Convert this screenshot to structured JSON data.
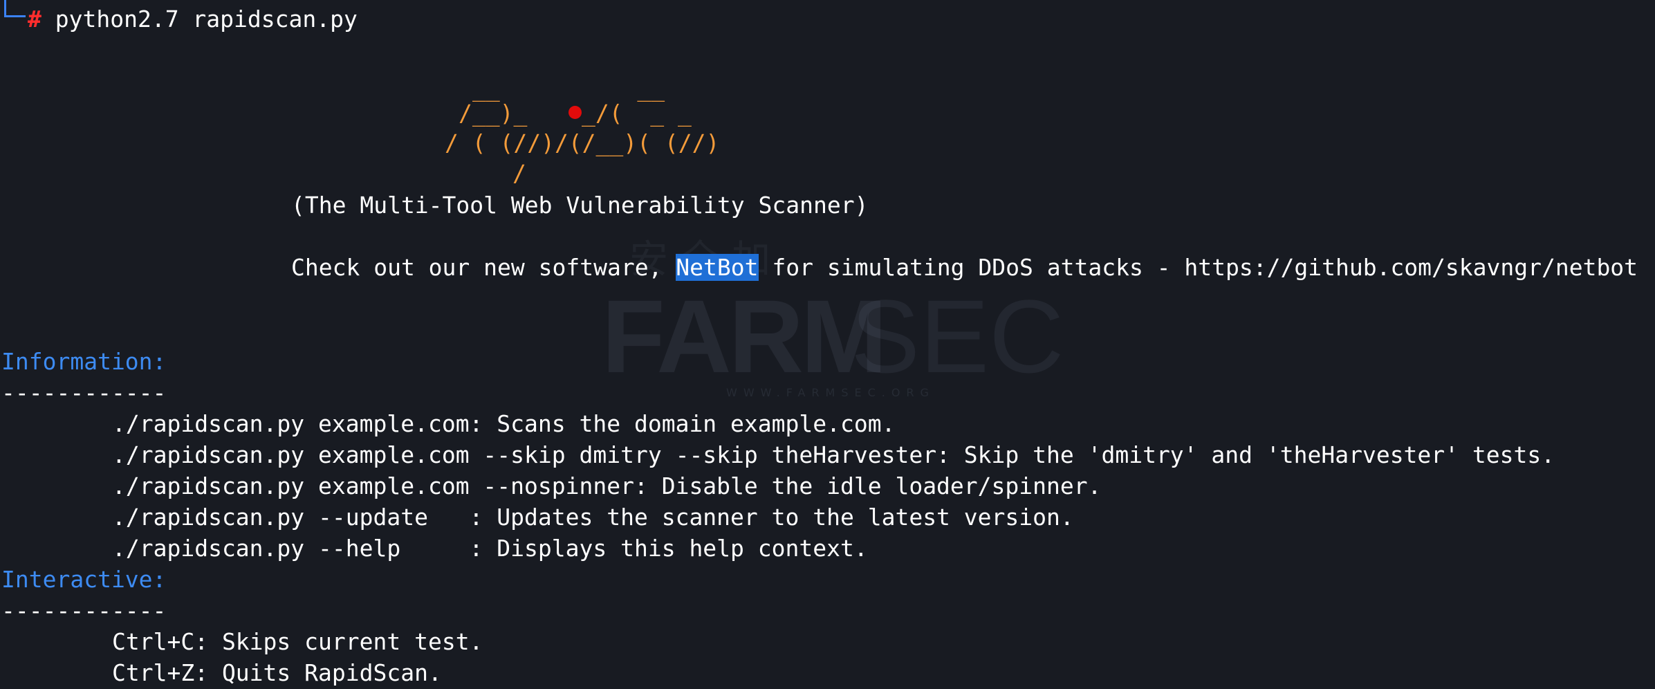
{
  "prompt": {
    "symbol": "#",
    "command": "python2.7 rapidscan.py"
  },
  "banner": {
    "art_line1": "__          __",
    "art_line2a": "/__)_   ",
    "art_line2b": "_/(  _ _",
    "art_line3": "/ ( (//)/(/__)( (//)",
    "art_line4": "/",
    "tagline": "(The Multi-Tool Web Vulnerability Scanner)",
    "promo_before": "Check out our new software, ",
    "promo_highlight": "NetBot",
    "promo_after": " for simulating DDoS attacks - https://github.com/skavngr/netbot"
  },
  "information": {
    "heading": "Information:",
    "rule": "------------",
    "lines": [
      "./rapidscan.py example.com: Scans the domain example.com.",
      "./rapidscan.py example.com --skip dmitry --skip theHarvester: Skip the 'dmitry' and 'theHarvester' tests.",
      "./rapidscan.py example.com --nospinner: Disable the idle loader/spinner.",
      "./rapidscan.py --update   : Updates the scanner to the latest version.",
      "./rapidscan.py --help     : Displays this help context."
    ]
  },
  "interactive": {
    "heading": "Interactive:",
    "rule": "------------",
    "lines": [
      "Ctrl+C: Skips current test.",
      "Ctrl+Z: Quits RapidScan."
    ]
  },
  "watermark": {
    "cn": "安全加",
    "farm": "FARM",
    "sec": "SEC",
    "url": "WWW.FARMSEC.ORG"
  },
  "colors": {
    "background": "#181b22",
    "text": "#ffffff",
    "banner": "#f39b3a",
    "section_heading": "#3d8bf2",
    "prompt_hash": "#ff2d2d",
    "selection": "#1f6fd6"
  }
}
